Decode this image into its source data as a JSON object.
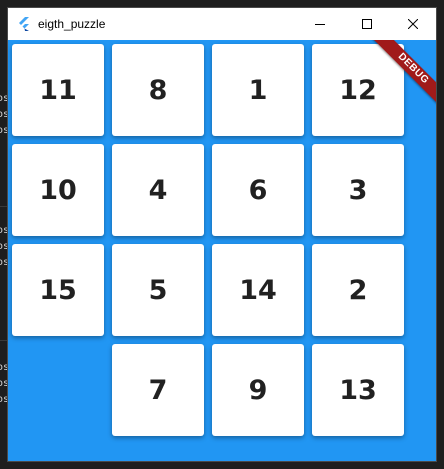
{
  "window": {
    "title": "eigth_puzzle",
    "icons": {
      "app": "flutter-logo-icon",
      "minimize": "minimize-icon",
      "maximize": "maximize-icon",
      "close": "close-icon"
    }
  },
  "debug_banner": {
    "label": "DEBUG",
    "color": "#a01a1a"
  },
  "puzzle": {
    "background_color": "#2196f3",
    "tiles": [
      "11",
      "8",
      "1",
      "12",
      "10",
      "4",
      "6",
      "3",
      "15",
      "5",
      "14",
      "2",
      "",
      "7",
      "9",
      "13"
    ]
  },
  "background_terminal": {
    "fragments": [
      "os",
      "os",
      "os",
      "os",
      "os",
      "os",
      "os",
      "os",
      "os"
    ]
  }
}
